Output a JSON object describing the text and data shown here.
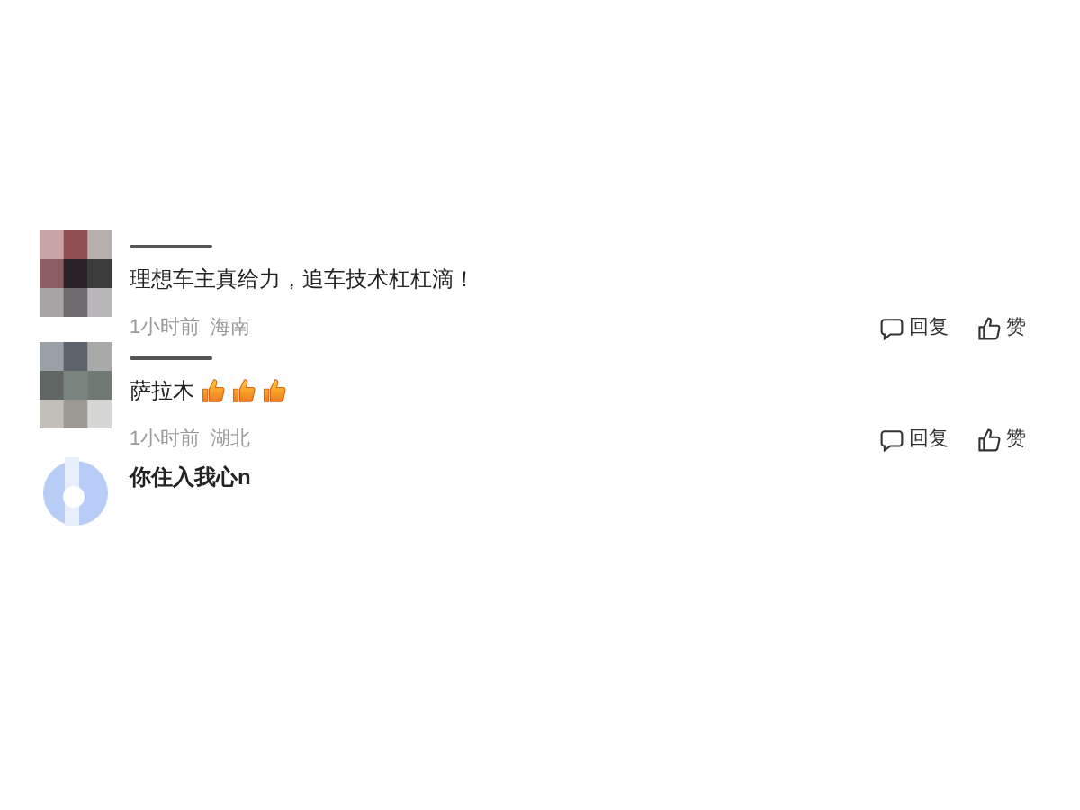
{
  "comments": [
    {
      "avatar": {
        "kind": "mosaic"
      },
      "name_hidden": true,
      "text": "理想车主真给力，追车技术杠杠滴！",
      "time": "1小时前",
      "location": "海南",
      "actions": {
        "reply": "回复",
        "like": "赞"
      }
    },
    {
      "avatar": {
        "kind": "mosaic"
      },
      "name_hidden": true,
      "text": "萨拉木",
      "emojis": [
        {
          "kind": "thumb"
        },
        {
          "kind": "thumb"
        },
        {
          "kind": "thumb"
        }
      ],
      "time": "1小时前",
      "location": "湖北",
      "actions": {
        "reply": "回复",
        "like": "赞"
      }
    },
    {
      "avatar": {
        "kind": "figure"
      },
      "name_hidden": false,
      "name": "你住入我心n"
    }
  ]
}
